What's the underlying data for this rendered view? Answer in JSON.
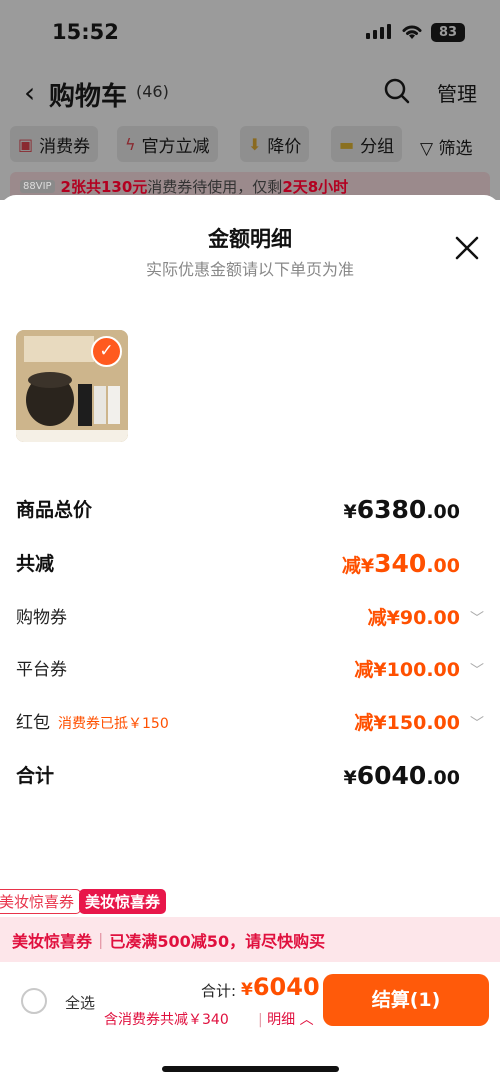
{
  "status_bar": {
    "time": "15:52",
    "battery": "83"
  },
  "header": {
    "back_icon": "chevron-left-icon",
    "title": "购物车",
    "count": "(46)",
    "manage": "管理"
  },
  "filters": [
    {
      "label": "消费券",
      "icon": "coupon-icon"
    },
    {
      "label": "官方立减",
      "icon": "lightning-icon"
    },
    {
      "label": "降价",
      "icon": "price-drop-icon"
    },
    {
      "label": "分组",
      "icon": "folder-icon"
    },
    {
      "label": "筛选",
      "icon": "filter-icon"
    }
  ],
  "promo": {
    "vip": "88VIP",
    "highlight": "2张共130元",
    "text": "消费券待使用，仅剩",
    "remaining": "2天8小时"
  },
  "sheet": {
    "title": "金额明细",
    "subtitle": "实际优惠金额请以下单页为准",
    "rows": {
      "subtotal": {
        "label": "商品总价",
        "currency": "¥",
        "int": "6380",
        "dec": ".00"
      },
      "total_discount": {
        "label": "共减",
        "prefix": "减¥",
        "int": "340",
        "dec": ".00"
      },
      "shop_coupon": {
        "label": "购物券",
        "prefix": "减¥",
        "int": "90",
        "dec": ".00"
      },
      "platform_coupon": {
        "label": "平台券",
        "prefix": "减¥",
        "int": "100",
        "dec": ".00"
      },
      "red_packet": {
        "label": "红包",
        "note": "消费券已抵￥150",
        "prefix": "减¥",
        "int": "150",
        "dec": ".00"
      },
      "grand_total": {
        "label": "合计",
        "currency": "¥",
        "int": "6040",
        "dec": ".00"
      }
    }
  },
  "tags": {
    "tag1": "美妆惊喜券",
    "tag2": "美妆惊喜券"
  },
  "banner": {
    "left": "美妆惊喜券",
    "right": "已凑满500减50，请尽快购买"
  },
  "bottom": {
    "select_all": "全选",
    "total_label": "合计:",
    "total_currency": "¥",
    "total_value": "6040",
    "discount_line": "含消费券共减￥340",
    "detail": "明细",
    "pay": "结算(1)"
  },
  "colors": {
    "accent": "#ff5000",
    "pay_button": "#ff5a0a",
    "promo_red": "#e0103e"
  }
}
